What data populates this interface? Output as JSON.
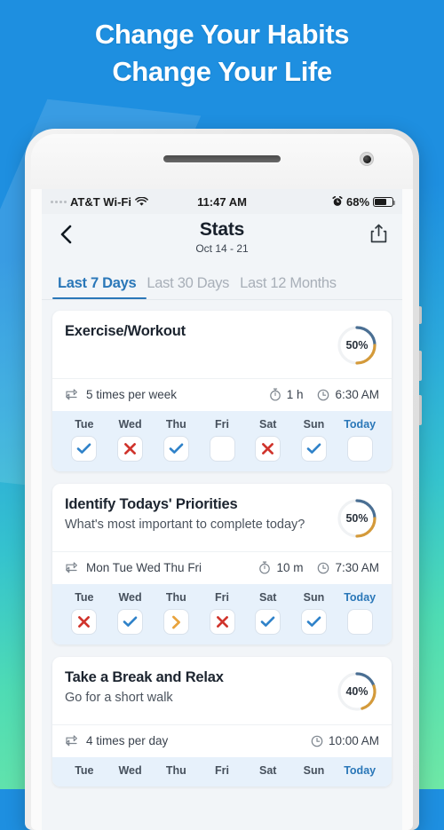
{
  "promo": {
    "line1": "Change Your Habits",
    "line2": "Change Your Life"
  },
  "colors": {
    "bg_top": "#1E8FE0",
    "bg_bottom": "#6FE8A6",
    "accent_blue": "#2a77b8",
    "check_blue": "#2f82c9",
    "cross_red": "#d0342c",
    "skip_orange": "#e8a33d",
    "ring_blue": "#4a6f93",
    "ring_orange": "#d49a3a",
    "day_strip": "#e7f1fb"
  },
  "status_bar": {
    "carrier": "AT&T Wi-Fi",
    "wifi_icon": "wifi-icon",
    "signal_icon": "signal-dots-icon",
    "time": "11:47 AM",
    "alarm_icon": "alarm-clock-icon",
    "battery_percent": "68%",
    "battery_icon": "battery-icon"
  },
  "header": {
    "back_icon": "back-chevron-icon",
    "title": "Stats",
    "subtitle": "Oct 14 - 21",
    "share_icon": "share-icon"
  },
  "tabs": [
    {
      "label": "Last 7 Days",
      "active": true
    },
    {
      "label": "Last 30 Days",
      "active": false
    },
    {
      "label": "Last 12 Months",
      "active": false
    }
  ],
  "cards": [
    {
      "title": "Exercise/Workout",
      "subtitle": "",
      "progress": "50%",
      "progress_value": 50,
      "repeat_icon": "repeat-icon",
      "repeat": "5 times per week",
      "duration_icon": "stopwatch-icon",
      "duration": "1 h",
      "time_icon": "clock-icon",
      "time": "6:30 AM",
      "days": [
        {
          "label": "Tue",
          "state": "done"
        },
        {
          "label": "Wed",
          "state": "failed"
        },
        {
          "label": "Thu",
          "state": "done"
        },
        {
          "label": "Fri",
          "state": "empty"
        },
        {
          "label": "Sat",
          "state": "failed"
        },
        {
          "label": "Sun",
          "state": "done"
        },
        {
          "label": "Today",
          "state": "empty"
        }
      ]
    },
    {
      "title": "Identify Todays' Priorities",
      "subtitle": "What's most important to complete today?",
      "progress": "50%",
      "progress_value": 50,
      "repeat_icon": "repeat-icon",
      "repeat": "Mon Tue Wed Thu Fri",
      "duration_icon": "stopwatch-icon",
      "duration": "10 m",
      "time_icon": "clock-icon",
      "time": "7:30 AM",
      "days": [
        {
          "label": "Tue",
          "state": "failed"
        },
        {
          "label": "Wed",
          "state": "done"
        },
        {
          "label": "Thu",
          "state": "skipped"
        },
        {
          "label": "Fri",
          "state": "failed"
        },
        {
          "label": "Sat",
          "state": "done"
        },
        {
          "label": "Sun",
          "state": "done"
        },
        {
          "label": "Today",
          "state": "empty"
        }
      ]
    },
    {
      "title": "Take a Break and Relax",
      "subtitle": "Go for a short walk",
      "progress": "40%",
      "progress_value": 40,
      "repeat_icon": "repeat-icon",
      "repeat": "4 times per day",
      "duration_icon": "",
      "duration": "",
      "time_icon": "clock-icon",
      "time": "10:00 AM",
      "days": [
        {
          "label": "Tue",
          "state": "empty"
        },
        {
          "label": "Wed",
          "state": "empty"
        },
        {
          "label": "Thu",
          "state": "empty"
        },
        {
          "label": "Fri",
          "state": "empty"
        },
        {
          "label": "Sat",
          "state": "empty"
        },
        {
          "label": "Sun",
          "state": "empty"
        },
        {
          "label": "Today",
          "state": "empty"
        }
      ]
    }
  ]
}
